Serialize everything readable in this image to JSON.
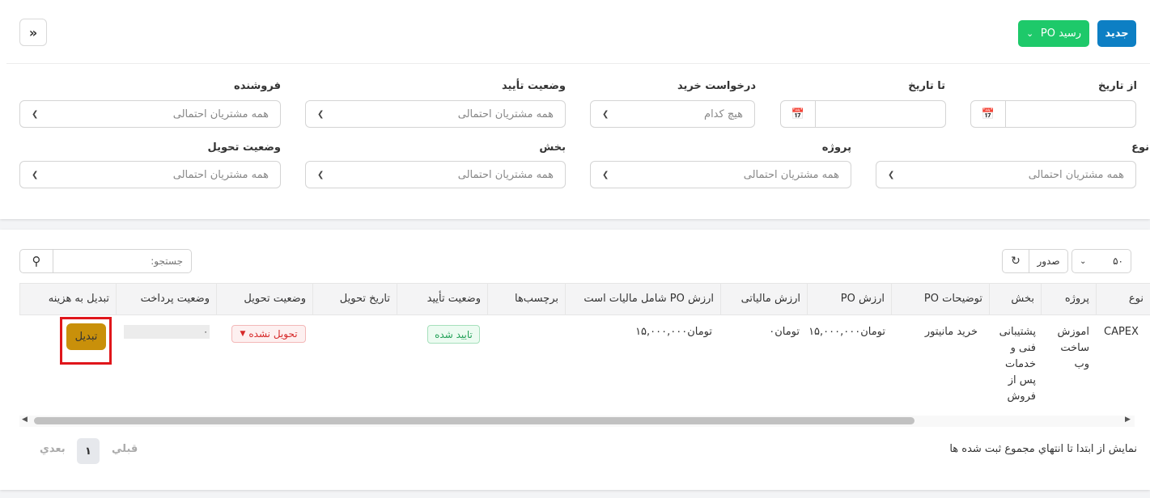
{
  "toolbar": {
    "new_label": "جدید",
    "po_receipt_label": "رسید PO",
    "collapse_icon": "double-chevron-right-icon"
  },
  "filters": {
    "from_date_label": "از تاریخ",
    "to_date_label": "تا تاریخ",
    "purchase_request_label": "درخواست خرید",
    "purchase_request_value": "هیچ کدام",
    "approval_status_label": "وضعیت تأیید",
    "approval_status_value": "همه مشتریان احتمالی",
    "vendor_label": "فروشنده",
    "vendor_value": "همه مشتریان احتمالی",
    "type_label": "نوع",
    "type_value": "همه مشتریان احتمالی",
    "project_label": "پروژه",
    "project_value": "همه مشتریان احتمالی",
    "department_label": "بخش",
    "department_value": "همه مشتریان احتمالی",
    "delivery_status_label": "وضعیت تحویل",
    "delivery_status_value": "همه مشتریان احتمالی"
  },
  "table_controls": {
    "page_size": "۵۰",
    "export_label": "صدور",
    "search_placeholder": "جستجو:"
  },
  "columns": [
    "نوع",
    "پروژه",
    "بخش",
    "توضیحات PO",
    "ارزش PO",
    "ارزش مالیاتی",
    "ارزش PO شامل مالیات است",
    "برچسب‌ها",
    "وضعیت تأیید",
    "تاریخ تحویل",
    "وضعیت تحویل",
    "وضعیت پرداخت",
    "تبدیل به هزینه"
  ],
  "row": {
    "type": "CAPEX",
    "project": "اموزش ساخت وب",
    "department": "پشتیبانی فنی و خدمات پس از فروش",
    "description": "خرید مانیتور",
    "po_value": "تومان۱۵,۰۰۰,۰۰۰",
    "tax_value": "تومان۰",
    "po_value_with_tax": "تومان۱۵,۰۰۰,۰۰۰",
    "tags": "",
    "approval_status": "تایید شده",
    "delivery_date": "",
    "delivery_status": "تحویل نشده",
    "payment_status": "۰",
    "convert_label": "تبدیل"
  },
  "pagination": {
    "info": "نمایش از ابتدا تا انتهاي مجموع ثبت شده ها",
    "prev": "قبلي",
    "page": "۱",
    "next": "بعدي"
  },
  "colors": {
    "primary": "#0d7fc4",
    "success": "#1ec96a",
    "warning": "#c9900a",
    "highlight": "#e0161b"
  }
}
